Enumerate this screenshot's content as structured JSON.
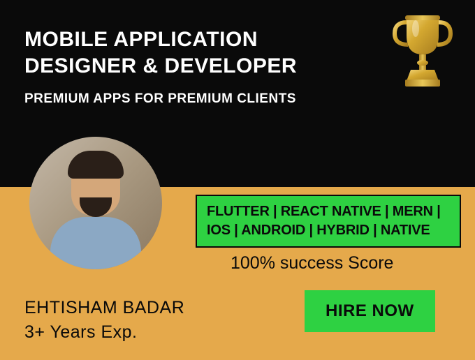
{
  "header": {
    "title_line1": "MOBILE APPLICATION",
    "title_line2": "DESIGNER & DEVELOPER",
    "subtitle": "PREMIUM APPS FOR PREMIUM CLIENTS"
  },
  "skills": "FLUTTER | REACT NATIVE | MERN | IOS | ANDROID | HYBRID | NATIVE",
  "score": "100% success Score",
  "cta": "HIRE NOW",
  "profile": {
    "name": "EHTISHAM BADAR",
    "experience": "3+ Years Exp."
  },
  "icons": {
    "trophy": "trophy-icon"
  },
  "colors": {
    "black": "#0a0a0a",
    "green": "#2ed142",
    "gold": "#e5a94b"
  }
}
